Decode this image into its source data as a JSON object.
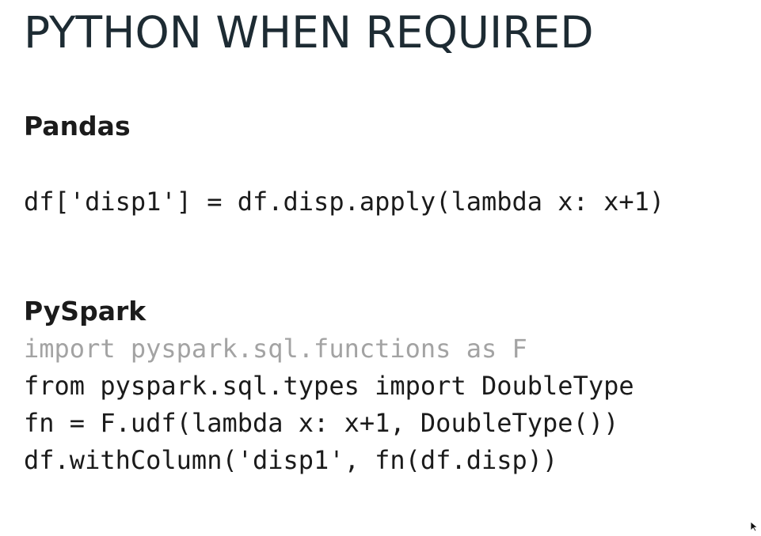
{
  "title": "PYTHON WHEN REQUIRED",
  "sections": [
    {
      "heading": "Pandas",
      "code": [
        "df['disp1'] = df.disp.apply(lambda x: x+1)"
      ]
    },
    {
      "heading": "PySpark",
      "code": [
        "import pyspark.sql.functions as F",
        "from pyspark.sql.types import DoubleType",
        "fn = F.udf(lambda x: x+1, DoubleType())",
        "df.withColumn('disp1', fn(df.disp))"
      ]
    }
  ],
  "icons": {
    "cursor": "mouse-pointer-icon"
  },
  "colors": {
    "title": "#1d2b33",
    "text": "#1b1b1b",
    "muted_code": "#a3a3a3",
    "background": "#ffffff"
  }
}
